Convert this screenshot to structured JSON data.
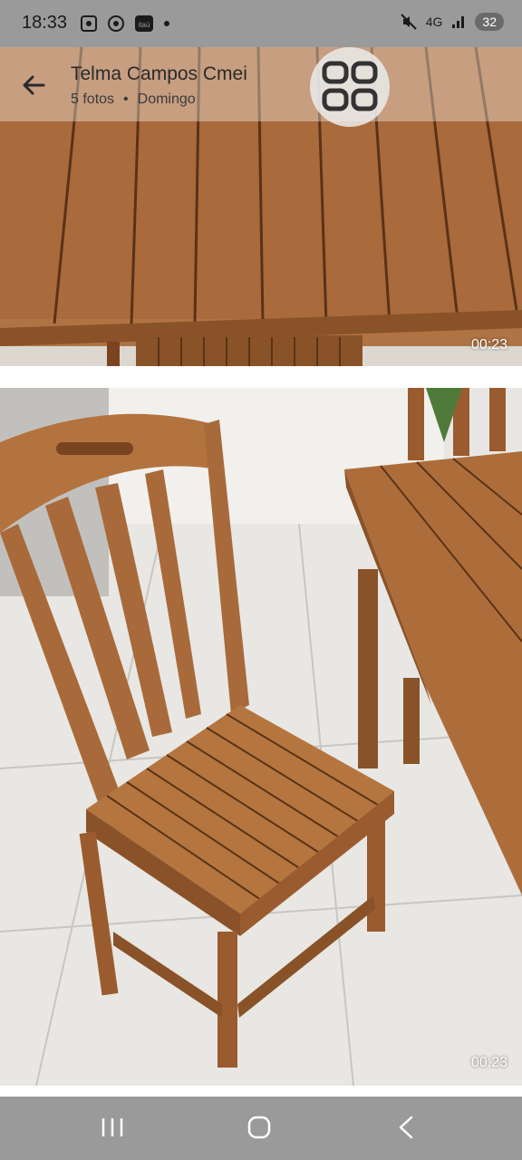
{
  "status_bar": {
    "time": "18:33",
    "network": "4G",
    "battery": "32",
    "icons": [
      "screenshot-icon",
      "chrome-icon",
      "itau-app-icon",
      "dot-icon",
      "mute-icon",
      "network-icon",
      "signal-icon"
    ]
  },
  "header": {
    "title": "Telma Campos Cmei",
    "photo_count": "5 fotos",
    "separator": "•",
    "day": "Domingo"
  },
  "media": [
    {
      "subject": "wooden-slatted-table-top",
      "duration": "00:23"
    },
    {
      "subject": "wooden-chair-and-table",
      "duration": "00:23"
    }
  ],
  "colors": {
    "status_bar": "#9a9a9a",
    "nav_bar": "#9a9a9a",
    "wood": "#a86a3a",
    "floor": "#e9e9e7"
  },
  "nav": {
    "icons": [
      "recent-apps-icon",
      "home-icon",
      "back-icon"
    ]
  }
}
